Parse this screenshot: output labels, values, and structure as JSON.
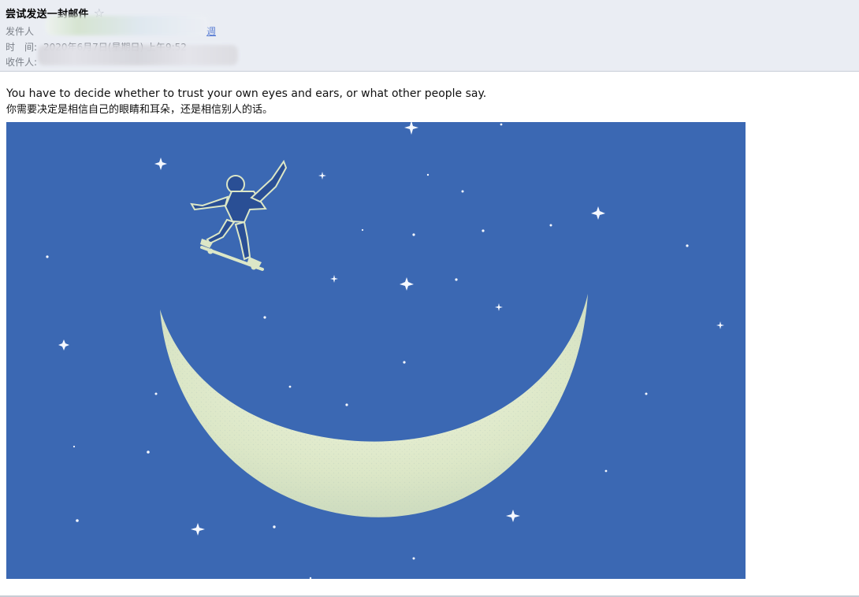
{
  "header": {
    "subject": "尝试发送一封邮件",
    "star_icon": "star-icon",
    "sender_label": "发件人",
    "time_label": "时　间:",
    "time_value": "2020年6月7日(星期日) 上午9:52",
    "recipient_label": "收件人:",
    "sender_link_fragment": "週"
  },
  "message": {
    "english_line": "You have to decide whether to trust your own eyes and ears, or what other people say.",
    "chinese_line": "你需要决定是相信自己的眼睛和耳朵，还是相信别人的话。"
  },
  "illustration": {
    "background_color": "#3b68b3",
    "moon_color": "#dfe7c8",
    "skater_color": "#2a4f95",
    "star_color": "#f5f8ff"
  }
}
